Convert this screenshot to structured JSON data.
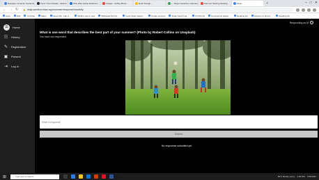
{
  "browser": {
    "tabs": [
      {
        "label": "Navigate | Amazon Credentials…",
        "color": "#4285f4",
        "active": false
      },
      {
        "label": "Topic / Post Details - GitHub…",
        "color": "#24292e",
        "active": false
      },
      {
        "label": "Who Was Jackie Robinson…",
        "color": "#1a73e8",
        "active": false
      },
      {
        "label": "Images - Ashley Brant…",
        "color": "#ea4335",
        "active": false
      },
      {
        "label": "Hotel Design…",
        "color": "#fbbc04",
        "active": false
      },
      {
        "label": "— Ninja Interactive Learning…",
        "color": "#34a853",
        "active": false
      },
      {
        "label": "Summer Starting Starting…",
        "color": "#e8453c",
        "active": false
      },
      {
        "label": "Ninja…",
        "color": "#4285f4",
        "active": true
      }
    ],
    "new_tab": "+",
    "window_controls": [
      "–",
      "□",
      "✕"
    ],
    "url": "ninja.sandbox.learn.app/summer/response/#/activity",
    "bookmarks": [
      "Apps",
      "Mail",
      "YouTube",
      "Maps",
      "News 101 - Day 1…",
      "What's new in now",
      "Wikipedia Tell No…",
      "Color Mode Select…",
      "Create Account",
      "Scale Stock Ima…",
      "COVID-19",
      "Coronavirus status…",
      "Reading list",
      "Pearson & Stronz…",
      "Reading list"
    ]
  },
  "sidebar": {
    "items": [
      {
        "label": "Home",
        "icon": "☰"
      },
      {
        "label": "History",
        "icon": "☷"
      },
      {
        "label": "Registration",
        "icon": "✎"
      },
      {
        "label": "Present",
        "icon": "▣"
      },
      {
        "label": "Log In",
        "icon": "⇥"
      }
    ]
  },
  "header": {
    "responding_as": "Responding as M"
  },
  "question": {
    "title": "What is one word that describes the best part of your summer? (Photo by Robert Collins on Unsplash)",
    "subtitle": "You have not responded",
    "response_placeholder": "Enter a response",
    "submit_label": "Submit",
    "no_responses": "No responses submitted yet."
  },
  "taskbar": {
    "search_placeholder": "Type here to search",
    "apps": [
      "#3a3a3a",
      "#2b7de9",
      "#f2c811",
      "#0078d7",
      "#d83b01",
      "#e81123",
      "#2b579a"
    ],
    "clock": "4:02 PM",
    "date": "7/26/2021",
    "weather": "83°F Mostly sunny"
  },
  "colors": {
    "sidebar_bg": "#1f1f1f",
    "main_bg": "#000000",
    "submit_bg": "#c7c7c7"
  }
}
